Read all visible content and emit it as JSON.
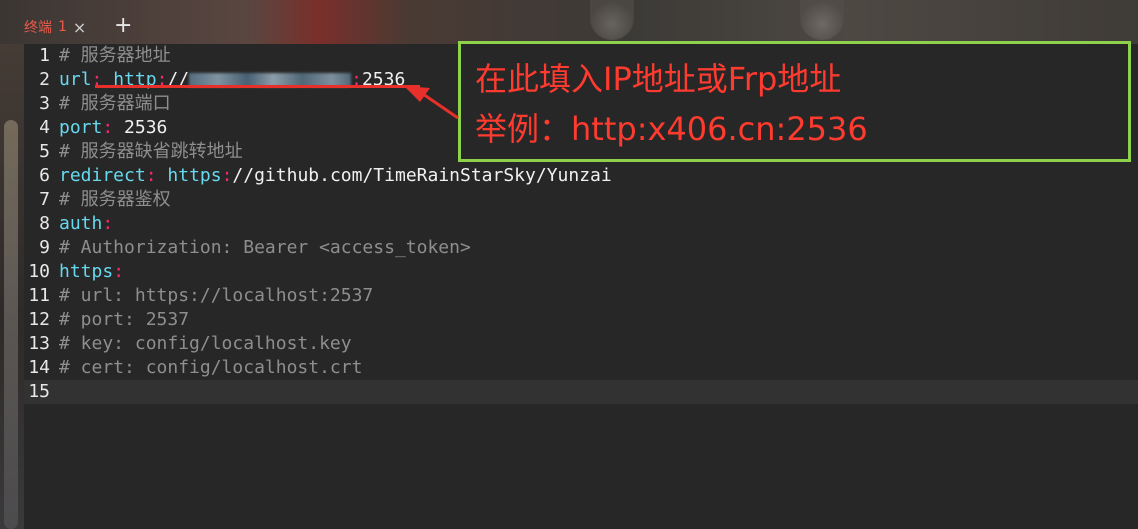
{
  "tab": {
    "title": "终端",
    "index": "1",
    "close_glyph": "×"
  },
  "new_tab_glyph": "+",
  "lines": [
    {
      "num": "1",
      "parts": [
        {
          "t": "# 服务器地址",
          "c": "comment"
        }
      ]
    },
    {
      "num": "2",
      "parts": [
        {
          "t": "url",
          "c": "key"
        },
        {
          "t": ": ",
          "c": "punct"
        },
        {
          "t": "http",
          "c": "key"
        },
        {
          "t": ":",
          "c": "punct"
        },
        {
          "t": "//",
          "c": "val"
        },
        {
          "t": "",
          "c": "blur"
        },
        {
          "t": ":",
          "c": "punct"
        },
        {
          "t": "2536",
          "c": "val"
        }
      ]
    },
    {
      "num": "3",
      "parts": [
        {
          "t": "# 服务器端口",
          "c": "comment"
        }
      ]
    },
    {
      "num": "4",
      "parts": [
        {
          "t": "port",
          "c": "key"
        },
        {
          "t": ": ",
          "c": "punct"
        },
        {
          "t": "2536",
          "c": "val"
        }
      ]
    },
    {
      "num": "5",
      "parts": [
        {
          "t": "# 服务器缺省跳转地址",
          "c": "comment"
        }
      ]
    },
    {
      "num": "6",
      "parts": [
        {
          "t": "redirect",
          "c": "key"
        },
        {
          "t": ": ",
          "c": "punct"
        },
        {
          "t": "https",
          "c": "key"
        },
        {
          "t": ":",
          "c": "punct"
        },
        {
          "t": "//github.com/TimeRainStarSky/Yunzai",
          "c": "val"
        }
      ]
    },
    {
      "num": "7",
      "parts": [
        {
          "t": "# 服务器鉴权",
          "c": "comment"
        }
      ]
    },
    {
      "num": "8",
      "parts": [
        {
          "t": "auth",
          "c": "key"
        },
        {
          "t": ":",
          "c": "punct"
        }
      ]
    },
    {
      "num": "9",
      "parts": [
        {
          "t": "# Authorization: Bearer <access_token>",
          "c": "comment"
        }
      ]
    },
    {
      "num": "10",
      "parts": [
        {
          "t": "https",
          "c": "key"
        },
        {
          "t": ":",
          "c": "punct"
        }
      ]
    },
    {
      "num": "11",
      "parts": [
        {
          "t": "# url: https://localhost:2537",
          "c": "comment"
        }
      ]
    },
    {
      "num": "12",
      "parts": [
        {
          "t": "# port: 2537",
          "c": "comment"
        }
      ]
    },
    {
      "num": "13",
      "parts": [
        {
          "t": "# key: config/localhost.key",
          "c": "comment"
        }
      ]
    },
    {
      "num": "14",
      "parts": [
        {
          "t": "# cert: config/localhost.crt",
          "c": "comment"
        }
      ]
    },
    {
      "num": "15",
      "parts": []
    }
  ],
  "annotation": {
    "line1": "在此填入IP地址或Frp地址",
    "line2": "举例：http:x406.cn:2536",
    "border_color": "#8ed14b",
    "text_color": "#ff3b2f"
  }
}
